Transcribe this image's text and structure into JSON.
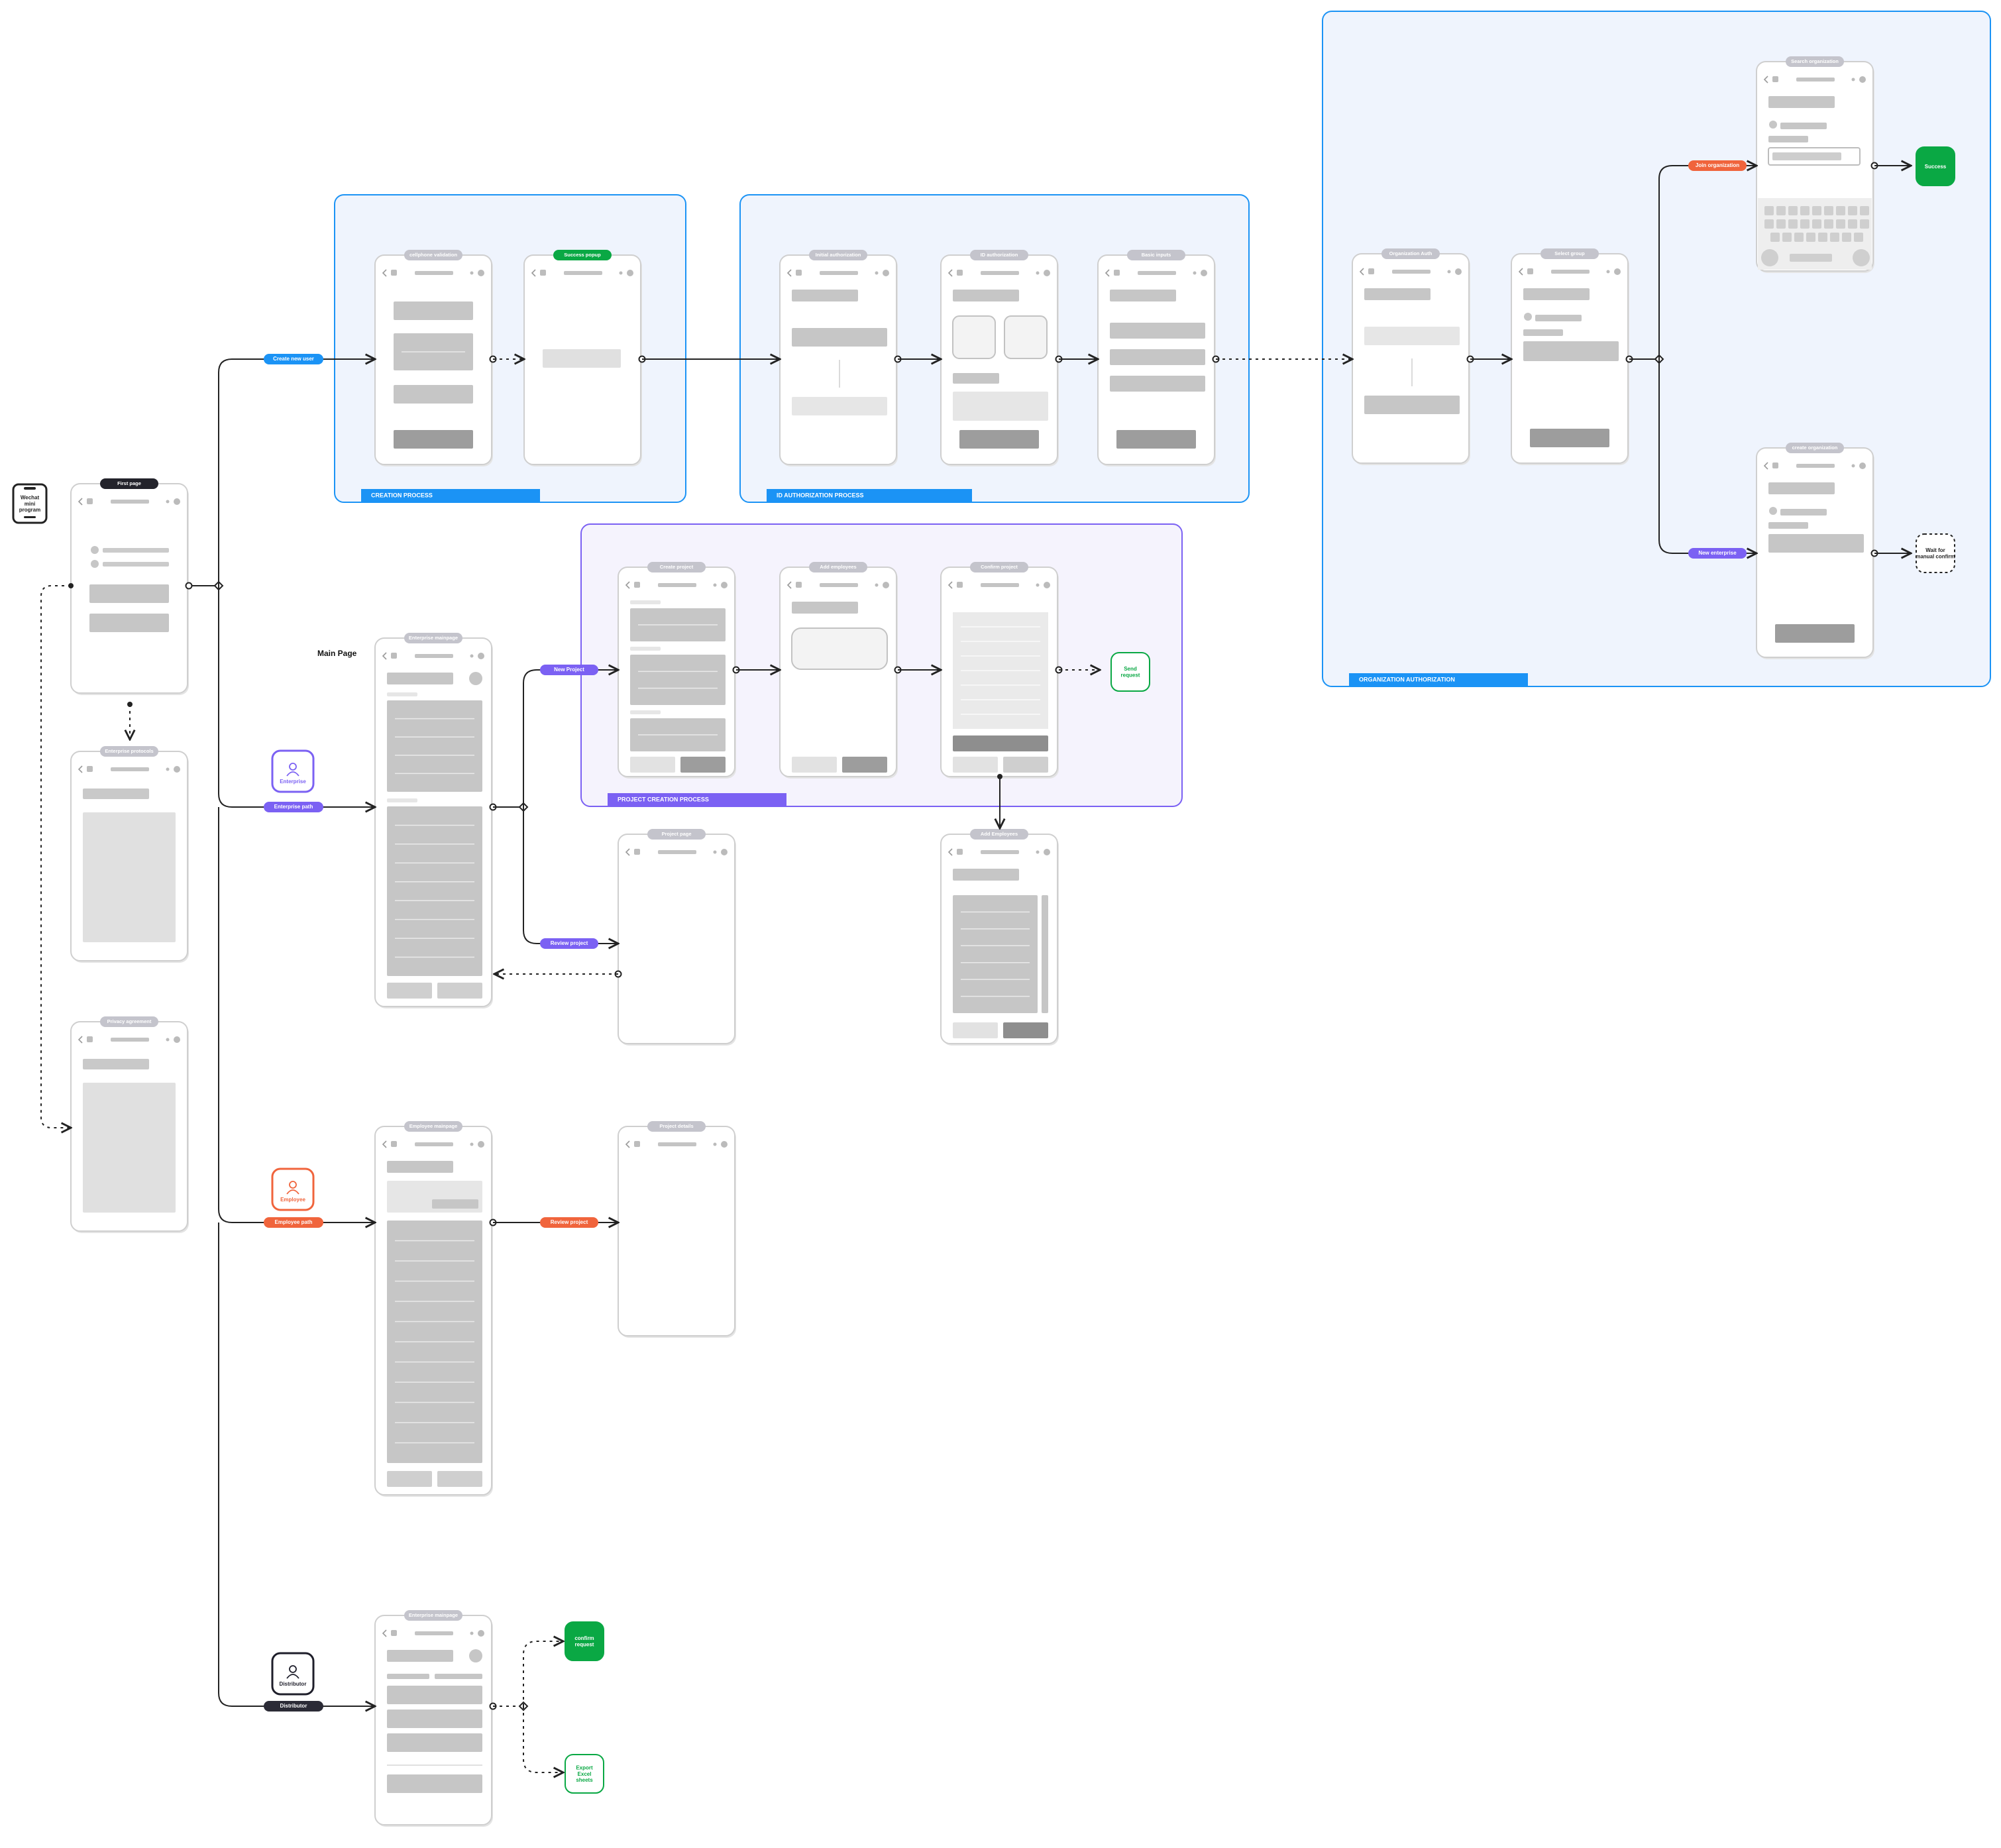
{
  "entry": {
    "label": "Wechat mini program"
  },
  "main_page_label": "Main Page",
  "processes": [
    {
      "id": "creation",
      "label": "CREATION PROCESS",
      "color": "#1b93f5"
    },
    {
      "id": "idauth",
      "label": "ID AUTHORIZATION PROCESS",
      "color": "#1b93f5"
    },
    {
      "id": "orgauth",
      "label": "ORGANIZATION AUTHORIZATION",
      "color": "#1b93f5"
    },
    {
      "id": "projcreate",
      "label": "PROJECT CREATION PROCESS",
      "color": "#7b61f3"
    }
  ],
  "roles": [
    {
      "id": "enterprise",
      "label": "Enterprise",
      "color": "#7b61f3",
      "icon": "people-icon"
    },
    {
      "id": "employee",
      "label": "Employee",
      "color": "#f0643c",
      "icon": "person-icon"
    },
    {
      "id": "distributor",
      "label": "Distributor",
      "color": "#1e1e2a",
      "icon": "people-icon"
    }
  ],
  "branch_tags": [
    {
      "id": "create-new-user",
      "label": "Create new user",
      "color": "#1b93f5"
    },
    {
      "id": "enterprise-path",
      "label": "Enterprise path",
      "color": "#7b61f3"
    },
    {
      "id": "employee-path",
      "label": "Employee path",
      "color": "#f0643c"
    },
    {
      "id": "distributor",
      "label": "Distributor",
      "color": "#2b2b36"
    },
    {
      "id": "new-project",
      "label": "New Project",
      "color": "#7b61f3"
    },
    {
      "id": "review-project-ent",
      "label": "Review project",
      "color": "#7b61f3"
    },
    {
      "id": "review-project-emp",
      "label": "Review project",
      "color": "#f0643c"
    },
    {
      "id": "join-organization",
      "label": "Join organization",
      "color": "#f0643c"
    },
    {
      "id": "new-enterprise",
      "label": "New enterprise",
      "color": "#7b61f3"
    }
  ],
  "screens": [
    {
      "id": "first",
      "title": "First page",
      "dark_title": true
    },
    {
      "id": "ent-protocols",
      "title": "Enterprise protocols"
    },
    {
      "id": "privacy",
      "title": "Privacy agreement"
    },
    {
      "id": "cellphone",
      "title": "cellphone validation"
    },
    {
      "id": "success-popup",
      "title": "Success popup",
      "green_title": true
    },
    {
      "id": "initial-auth",
      "title": "Initial authorization"
    },
    {
      "id": "id-auth",
      "title": "ID authorization"
    },
    {
      "id": "basic-inputs",
      "title": "Basic inputs"
    },
    {
      "id": "org-auth",
      "title": "Organization Auth"
    },
    {
      "id": "select-group",
      "title": "Select group"
    },
    {
      "id": "search-org",
      "title": "Search organization"
    },
    {
      "id": "create-org",
      "title": "create organization"
    },
    {
      "id": "ent-mainpage",
      "title": "Enterprise mainpage"
    },
    {
      "id": "create-project",
      "title": "Create project"
    },
    {
      "id": "add-employees",
      "title": "Add employees"
    },
    {
      "id": "confirm-project",
      "title": "Confirm project"
    },
    {
      "id": "project-page",
      "title": "Project page"
    },
    {
      "id": "add-employees2",
      "title": "Add Employees"
    },
    {
      "id": "emp-mainpage",
      "title": "Employee mainpage"
    },
    {
      "id": "project-details",
      "title": "Project details"
    },
    {
      "id": "dist-mainpage",
      "title": "Enterprise mainpage"
    }
  ],
  "outcomes": [
    {
      "id": "success",
      "label": "Success",
      "style": "green-solid"
    },
    {
      "id": "wait-confirm",
      "label": "Wait for manual confirm",
      "style": "dashed-dark"
    },
    {
      "id": "send-request",
      "label": "Send request",
      "style": "green-outline"
    },
    {
      "id": "confirm-request",
      "label": "confirm request",
      "style": "green-solid"
    },
    {
      "id": "export-excel",
      "label": "Export Excel sheets",
      "style": "green-outline"
    }
  ]
}
